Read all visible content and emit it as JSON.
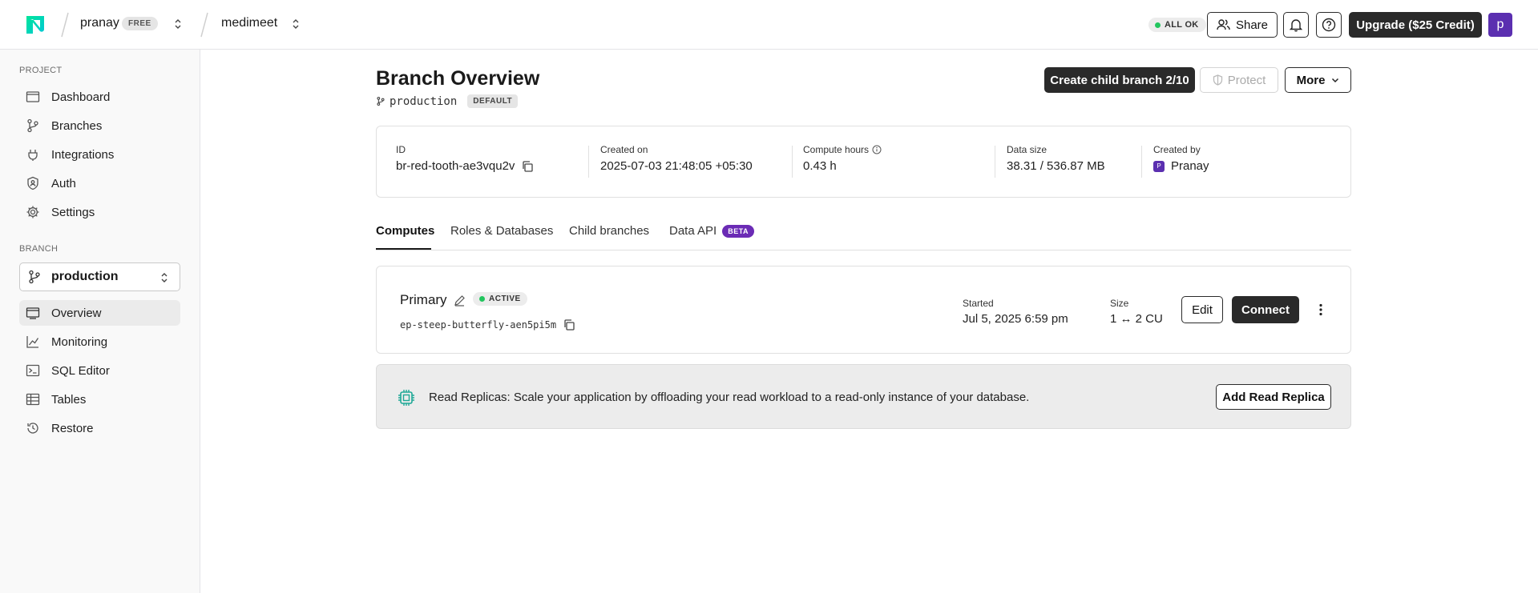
{
  "header": {
    "org_name": "pranay",
    "org_plan_badge": "FREE",
    "project_name": "medimeet",
    "status_badge": "ALL OK",
    "share_label": "Share",
    "upgrade_label": "Upgrade ($25 Credit)",
    "avatar_initial": "p",
    "icons": [
      "neon-logo-icon",
      "chevron-updown-icon",
      "users-icon",
      "bell-icon",
      "help-icon"
    ]
  },
  "sidebar": {
    "project_section_label": "PROJECT",
    "project_items": [
      {
        "label": "Dashboard",
        "icon": "dashboard-icon"
      },
      {
        "label": "Branches",
        "icon": "branch-icon"
      },
      {
        "label": "Integrations",
        "icon": "integrations-icon"
      },
      {
        "label": "Auth",
        "icon": "shield-user-icon"
      },
      {
        "label": "Settings",
        "icon": "gear-icon"
      }
    ],
    "branch_section_label": "BRANCH",
    "branch_selector_value": "production",
    "branch_items": [
      {
        "label": "Overview",
        "icon": "overview-icon",
        "active": true
      },
      {
        "label": "Monitoring",
        "icon": "chart-line-icon"
      },
      {
        "label": "SQL Editor",
        "icon": "terminal-icon"
      },
      {
        "label": "Tables",
        "icon": "table-icon"
      },
      {
        "label": "Restore",
        "icon": "history-icon"
      }
    ]
  },
  "main": {
    "title": "Branch Overview",
    "branch_name": "production",
    "default_badge": "DEFAULT",
    "actions": {
      "create_child": "Create child branch 2/10",
      "protect": "Protect",
      "more": "More"
    },
    "info": {
      "id_label": "ID",
      "id_value": "br-red-tooth-ae3vqu2v",
      "created_on_label": "Created on",
      "created_on_value": "2025-07-03 21:48:05 +05:30",
      "compute_hours_label": "Compute hours",
      "compute_hours_value": "0.43 h",
      "data_size_label": "Data size",
      "data_size_value": "38.31 / 536.87 MB",
      "created_by_label": "Created by",
      "created_by_value": "Pranay",
      "created_by_initial": "P"
    },
    "tabs": [
      {
        "label": "Computes",
        "active": true
      },
      {
        "label": "Roles & Databases"
      },
      {
        "label": "Child branches"
      },
      {
        "label": "Data API",
        "badge": "BETA"
      }
    ],
    "compute": {
      "name": "Primary",
      "status": "ACTIVE",
      "endpoint": "ep-steep-butterfly-aen5pi5m",
      "started_label": "Started",
      "started_value": "Jul 5, 2025 6:59 pm",
      "size_label": "Size",
      "size_value": "1 ↔ 2 CU",
      "edit_label": "Edit",
      "connect_label": "Connect"
    },
    "replica": {
      "text": "Read Replicas: Scale your application by offloading your read workload to a read-only instance of your database.",
      "button": "Add Read Replica"
    }
  },
  "colors": {
    "primary_dark": "#2a2a2a",
    "accent_purple": "#5b2fb0",
    "beta_purple": "#6b2bb5",
    "status_green": "#22c55e",
    "logo_green": "#00e599"
  }
}
